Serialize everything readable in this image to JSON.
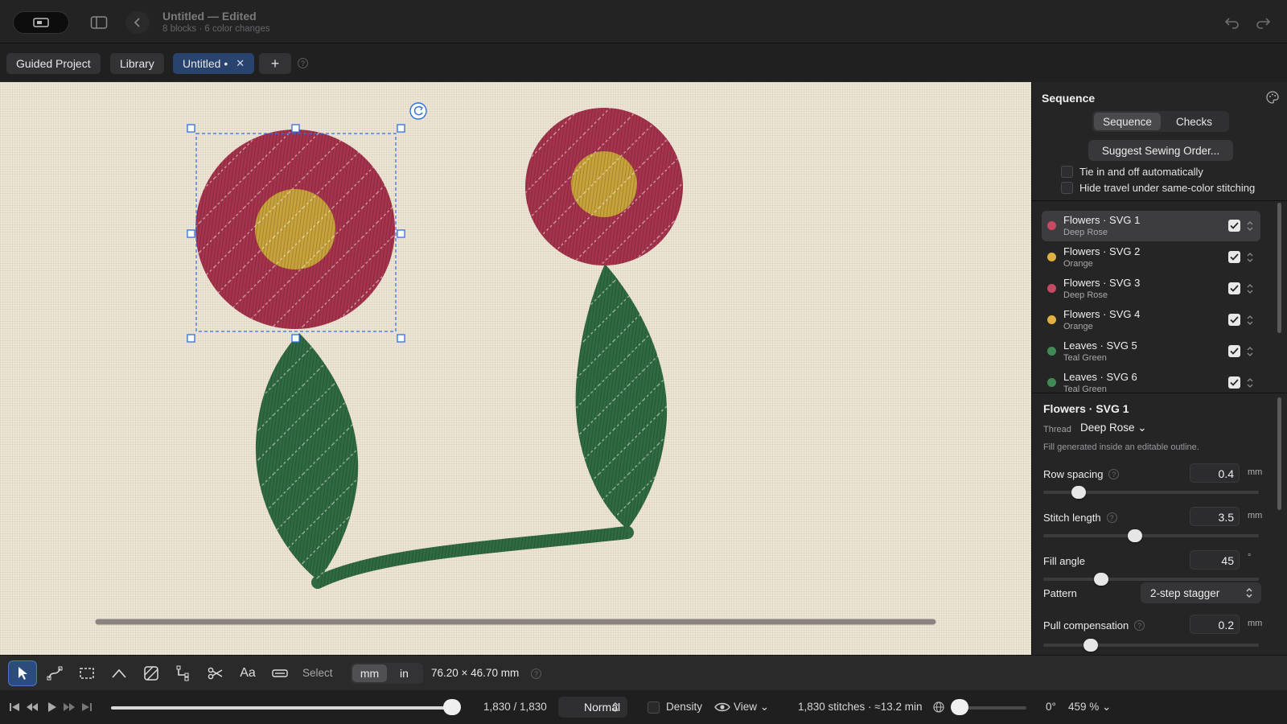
{
  "window": {
    "title": "Untitled — Edited",
    "subtitle": "8 blocks · 6 color changes"
  },
  "tabs": [
    {
      "label": "Guided Project"
    },
    {
      "label": "Library"
    },
    {
      "label": "Untitled •",
      "close": "✕"
    }
  ],
  "tab_add": "+",
  "help_glyph": "?",
  "panel": {
    "title": "Sequence",
    "segments": [
      "Sequence",
      "Checks"
    ],
    "suggest_label": "Suggest Sewing Order...",
    "options": [
      "Tie in and off automatically",
      "Hide travel under same-color stitching"
    ],
    "items": [
      {
        "name": "Flowers · SVG 1",
        "thread": "Deep Rose",
        "color": "#c84a60"
      },
      {
        "name": "Flowers · SVG 2",
        "thread": "Orange",
        "color": "#e0b040"
      },
      {
        "name": "Flowers · SVG 3",
        "thread": "Deep Rose",
        "color": "#c84a60"
      },
      {
        "name": "Flowers · SVG 4",
        "thread": "Orange",
        "color": "#e0b040"
      },
      {
        "name": "Leaves · SVG 5",
        "thread": "Teal Green",
        "color": "#3f8a55"
      },
      {
        "name": "Leaves · SVG 6",
        "thread": "Teal Green",
        "color": "#3f8a55"
      }
    ]
  },
  "properties": {
    "title": "Flowers · SVG 1",
    "thread_label": "Thread",
    "thread_value": "Deep Rose ⌄",
    "note": "Fill generated inside an editable outline.",
    "row_spacing": {
      "label": "Row spacing",
      "value": "0.4",
      "unit": "mm",
      "level": 0.14
    },
    "stitch_length": {
      "label": "Stitch length",
      "value": "3.5",
      "unit": "mm",
      "level": 0.42
    },
    "fill_angle": {
      "label": "Fill angle",
      "value": "45",
      "unit": "°",
      "level": 0.25
    },
    "pattern": {
      "label": "Pattern",
      "value": "2-step stagger"
    },
    "pull_comp": {
      "label": "Pull compensation",
      "value": "0.2",
      "unit": "mm",
      "level": 0.2
    }
  },
  "toolbar": {
    "mode_label": "Select",
    "units": [
      "mm",
      "in"
    ],
    "dimensions": "76.20 × 46.70 mm"
  },
  "playback": {
    "progress": 1.0,
    "counter": "1,830 / 1,830",
    "speed": "Normal",
    "density_label": "Density",
    "view_label": "View ⌄",
    "stats": "1,830 stitches · ≈13.2 min",
    "rotation": "0°",
    "zoom": "459 % ⌄"
  },
  "colors": {
    "deep_rose": "#a5334c",
    "orange": "#c8a23a",
    "teal_green": "#2f6a42",
    "selection": "#2f6fe0"
  }
}
